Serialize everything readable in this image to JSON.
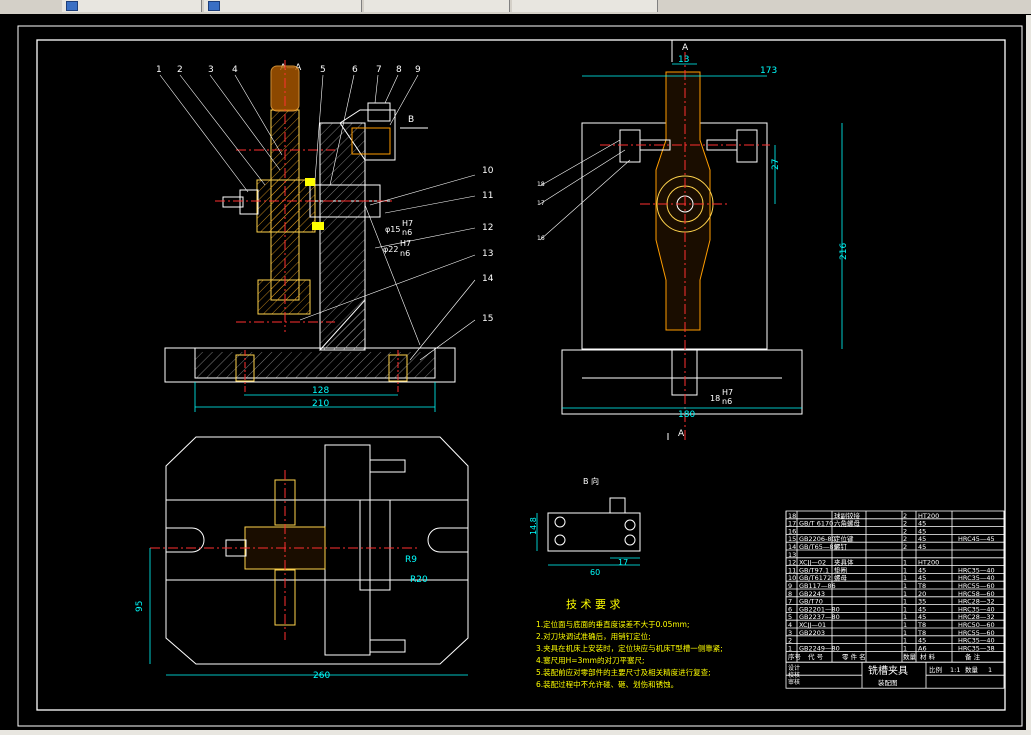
{
  "tabs": [
    "",
    "",
    "",
    ""
  ],
  "section": {
    "aa": "A—A",
    "b_view_arrow": "B",
    "b_view_title": "B 向",
    "a_top": "A",
    "a_bottom": "A"
  },
  "balloons": [
    "1",
    "2",
    "3",
    "4",
    "5",
    "6",
    "7",
    "8",
    "9",
    "10",
    "11",
    "12",
    "13",
    "14",
    "15",
    "16",
    "17",
    "18"
  ],
  "dims": {
    "d128": "128",
    "d210": "210",
    "d13": "13",
    "d173": "173",
    "d27": "27",
    "d216": "216",
    "d180": "180",
    "d18": "18",
    "fit_h7": "H7",
    "fit_n6": "n6",
    "fit_15": "φ15",
    "fit_22": "φ22",
    "d95": "95",
    "d260": "260",
    "r9": "R9",
    "r20": "R20",
    "d14": "14.8",
    "d60": "60",
    "d17": "17"
  },
  "tech": {
    "title": "技 术 要 求",
    "lines": [
      "1.定位面与底面的垂直度误差不大于0.05mm;",
      "2.对刀块调试准确后，用销钉定位;",
      "3.夹具在机床上安装时，定位块应与机床T型槽一侧靠紧;",
      "4.塞尺用H=3mm的对刀平塞尺;",
      "5.装配前应对零部件的主要尺寸及相关精度进行复查;",
      "6.装配过程中不允许碰、砸、划伤和锈蚀。"
    ]
  },
  "bom": {
    "rows": [
      {
        "no": "18",
        "code": "",
        "name": "球副铰接",
        "qty": "2",
        "mat": "HT200",
        "note": ""
      },
      {
        "no": "17",
        "code": "GB/T 6170",
        "name": "六角螺母",
        "qty": "2",
        "mat": "45",
        "note": ""
      },
      {
        "no": "16",
        "code": "",
        "name": "",
        "qty": "2",
        "mat": "45",
        "note": ""
      },
      {
        "no": "15",
        "code": "GB2206-80",
        "name": "定位键",
        "qty": "2",
        "mat": "45",
        "note": "HRC45—45"
      },
      {
        "no": "14",
        "code": "GB/T65—85",
        "name": "螺钉",
        "qty": "2",
        "mat": "45",
        "note": ""
      },
      {
        "no": "13",
        "code": "",
        "name": "",
        "qty": "",
        "mat": "",
        "note": ""
      },
      {
        "no": "12",
        "code": "XCJJ—02",
        "name": "夹具体",
        "qty": "1",
        "mat": "HT200",
        "note": ""
      },
      {
        "no": "11",
        "code": "GB/T97.1",
        "name": "垫圈",
        "qty": "1",
        "mat": "45",
        "note": "HRC35—40"
      },
      {
        "no": "10",
        "code": "GB/T6172",
        "name": "螺母",
        "qty": "1",
        "mat": "45",
        "note": "HRC35—40"
      },
      {
        "no": "9",
        "code": "GB117—86",
        "name": "",
        "qty": "1",
        "mat": "T8",
        "note": "HRC55—60"
      },
      {
        "no": "8",
        "code": "GB2243",
        "name": "",
        "qty": "1",
        "mat": "20",
        "note": "HRC58—60"
      },
      {
        "no": "7",
        "code": "GB/T70",
        "name": "",
        "qty": "1",
        "mat": "35",
        "note": "HRC28—32"
      },
      {
        "no": "6",
        "code": "GB2201—80",
        "name": "",
        "qty": "1",
        "mat": "45",
        "note": "HRC35—40"
      },
      {
        "no": "5",
        "code": "GB2237—80",
        "name": "",
        "qty": "1",
        "mat": "45",
        "note": "HRC28—32"
      },
      {
        "no": "4",
        "code": "XCJJ—01",
        "name": "",
        "qty": "1",
        "mat": "T8",
        "note": "HRC50—60"
      },
      {
        "no": "3",
        "code": "GB2203",
        "name": "",
        "qty": "1",
        "mat": "T8",
        "note": "HRC55—60"
      },
      {
        "no": "2",
        "code": "",
        "name": "",
        "qty": "1",
        "mat": "45",
        "note": "HRC35—40"
      },
      {
        "no": "1",
        "code": "GB2249—80",
        "name": "",
        "qty": "1",
        "mat": "A6",
        "note": "HRC35—38"
      }
    ],
    "header": {
      "no": "序号",
      "code": "代 号",
      "name": "零 件 名",
      "qty": "数量",
      "mat": "材 料",
      "note": "备 注"
    },
    "title": "铣槽夹具",
    "subtitle": "装配图",
    "scale_label": "比例",
    "scale": "1:1",
    "qty_label": "数量",
    "qty": "1",
    "roles": [
      "设计",
      "校核",
      "审核"
    ]
  },
  "colors": {
    "bg": "#000000",
    "white": "#ffffff",
    "yellow": "#ffff00",
    "cyan": "#00ffff",
    "red": "#ff3030",
    "orange": "#ff9d00",
    "hatch": "#e8c64a"
  }
}
